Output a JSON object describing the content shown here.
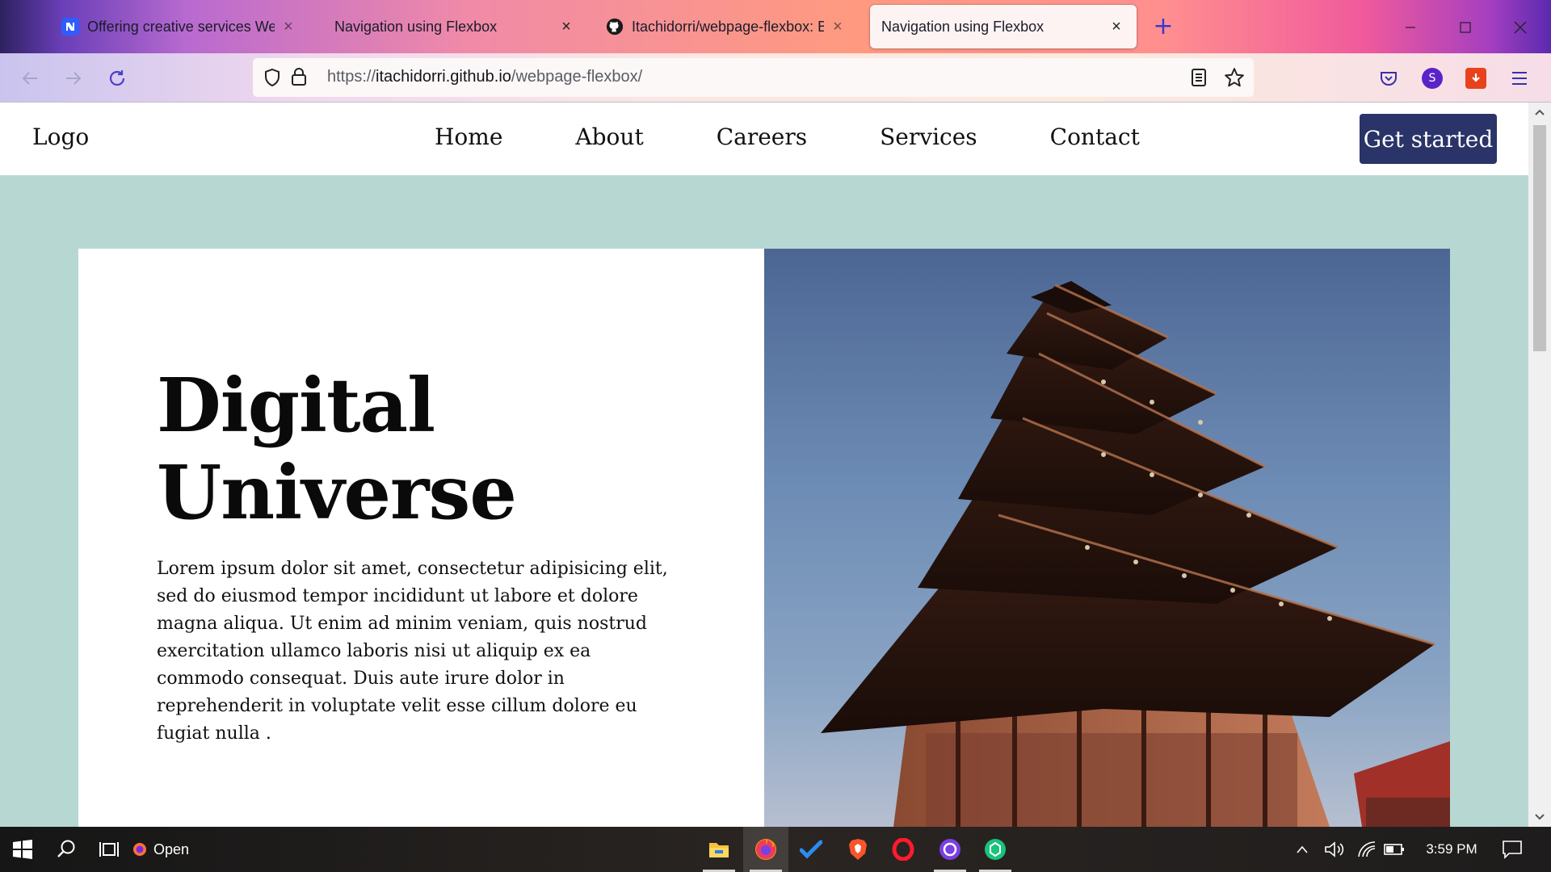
{
  "browser": {
    "tabs": [
      {
        "title": "Offering creative services Websi",
        "favicon": "n-app-icon",
        "active": false
      },
      {
        "title": "Navigation using Flexbox",
        "favicon": "",
        "active": false
      },
      {
        "title": "Itachidorri/webpage-flexbox: Bu",
        "favicon": "github-icon",
        "active": false
      },
      {
        "title": "Navigation using Flexbox",
        "favicon": "",
        "active": true
      }
    ],
    "new_tab_symbol": "+",
    "close_symbol": "×",
    "url_prefix": "https://",
    "url_domain": "itachidorri.github.io",
    "url_path": "/webpage-flexbox/",
    "profile_initial": "S"
  },
  "site": {
    "logo": "Logo",
    "nav": [
      "Home",
      "About",
      "Careers",
      "Services",
      "Contact"
    ],
    "cta": "Get started",
    "hero": {
      "title_line1": "Digital",
      "title_line2": "Universe",
      "body": "Lorem ipsum dolor sit amet, consectetur adipisicing elit, sed do eiusmod tempor incididunt ut labore et dolore magna aliqua. Ut enim ad minim veniam, quis nostrud exercitation ullamco laboris nisi ut aliquip ex ea commodo consequat. Duis aute irure dolor in reprehenderit in voluptate velit esse cillum dolore eu fugiat nulla ."
    },
    "colors": {
      "background": "#b7d8d2",
      "cta": "#2a3468"
    }
  },
  "taskbar": {
    "open_label": "Open",
    "time": "3:59 PM",
    "apps": [
      "file-explorer-icon",
      "firefox-icon",
      "todo-icon",
      "brave-icon",
      "opera-icon",
      "github-desktop-icon",
      "chatgpt-icon"
    ]
  }
}
